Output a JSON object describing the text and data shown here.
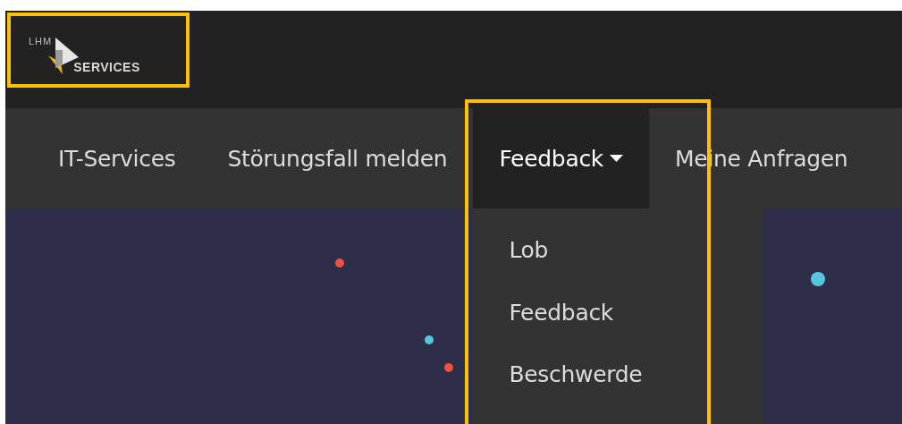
{
  "logo": {
    "line_1": "LHM",
    "line_2": "SERVICES",
    "highlighted": true
  },
  "nav": [
    {
      "label": "IT-Services",
      "selected": false
    },
    {
      "label": "Störungsfall melden",
      "selected": false
    },
    {
      "label": "Feedback",
      "selected": true,
      "expanded": true,
      "highlighted": true,
      "menu": [
        "Lob",
        "Feedback",
        "Beschwerde"
      ]
    },
    {
      "label": "Meine Anfragen",
      "selected": false
    }
  ]
}
